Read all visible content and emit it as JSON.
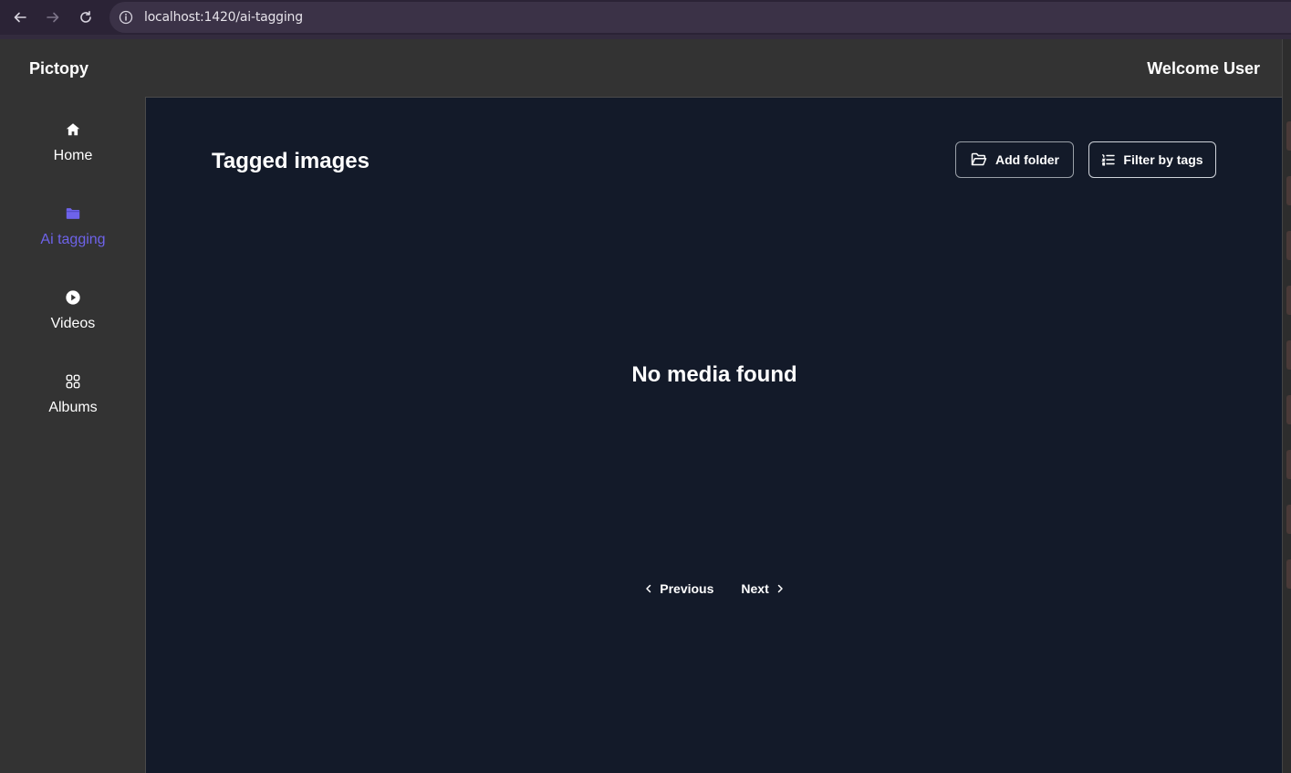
{
  "browser": {
    "url": "localhost:1420/ai-tagging",
    "back_icon": "arrow-left-icon",
    "forward_icon": "arrow-right-icon",
    "reload_icon": "reload-icon",
    "info_icon": "info-icon"
  },
  "header": {
    "brand": "Pictopy",
    "welcome": "Welcome User"
  },
  "sidebar": {
    "items": [
      {
        "label": "Home",
        "icon": "home-icon",
        "active": false
      },
      {
        "label": "Ai tagging",
        "icon": "folder-icon",
        "active": true
      },
      {
        "label": "Videos",
        "icon": "play-circle-icon",
        "active": false
      },
      {
        "label": "Albums",
        "icon": "grid-icon",
        "active": false
      }
    ]
  },
  "main": {
    "title": "Tagged images",
    "add_folder_label": "Add folder",
    "filter_label": "Filter by tags",
    "empty_text": "No media found",
    "pager": {
      "previous_label": "Previous",
      "next_label": "Next"
    }
  },
  "colors": {
    "accent": "#6e63ea",
    "main_bg": "#131a29",
    "sidebar_bg": "#333333"
  }
}
